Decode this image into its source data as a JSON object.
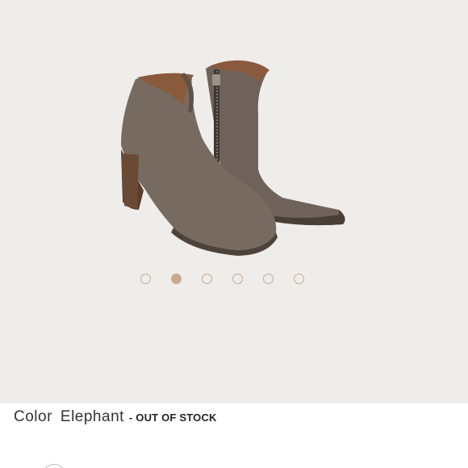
{
  "product": {
    "image_alt": "Suede ankle bootie with side zipper",
    "color_label": "Color",
    "color_value": "Elephant",
    "stock_status": "- OUT OF STOCK"
  },
  "carousel": {
    "count": 6,
    "active_index": 1
  },
  "colors": {
    "accent_dot": "#c9a98c",
    "background": "#efedea",
    "boot_suede": "#73675d"
  }
}
